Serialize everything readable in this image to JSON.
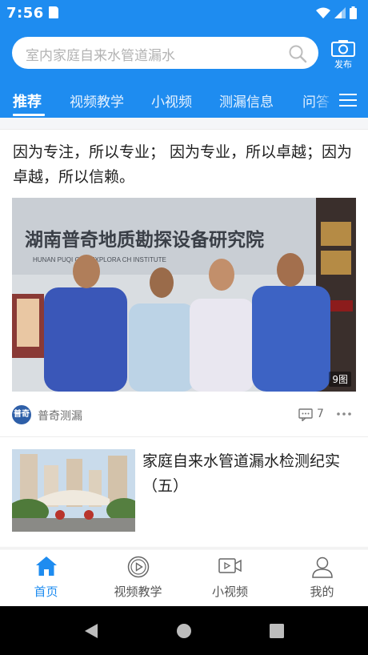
{
  "status_bar": {
    "time": "7:56"
  },
  "search": {
    "placeholder": "室内家庭自来水管道漏水"
  },
  "publish": {
    "label": "发布"
  },
  "tabs": [
    {
      "label": "推荐",
      "active": true
    },
    {
      "label": "视频教学",
      "active": false
    },
    {
      "label": "小视频",
      "active": false
    },
    {
      "label": "测漏信息",
      "active": false
    },
    {
      "label": "问答",
      "active": false
    }
  ],
  "feed": {
    "article1": {
      "title": "因为专注，所以专业； 因为专业，所以卓越；因为卓越，所以信赖。",
      "image_banner": "湖南普奇地质勘探设备研究院",
      "image_banner_en": "HUNAN PUQI G    AL EXPLORA              CH INSTITUTE",
      "image_count": "9图",
      "source_avatar": "普奇",
      "source_name": "普奇测漏",
      "comment_count": "7"
    },
    "article2": {
      "title": "家庭自来水管道漏水检测纪实（五）"
    }
  },
  "bottom_nav": [
    {
      "label": "首页",
      "icon": "home-icon",
      "active": true
    },
    {
      "label": "视频教学",
      "icon": "video-play-icon",
      "active": false
    },
    {
      "label": "小视频",
      "icon": "video-camera-icon",
      "active": false
    },
    {
      "label": "我的",
      "icon": "user-icon",
      "active": false
    }
  ],
  "colors": {
    "brand_blue": "#1e8cf0",
    "header_bg": "#1e8cf0",
    "active_text": "#1e8cf0"
  }
}
